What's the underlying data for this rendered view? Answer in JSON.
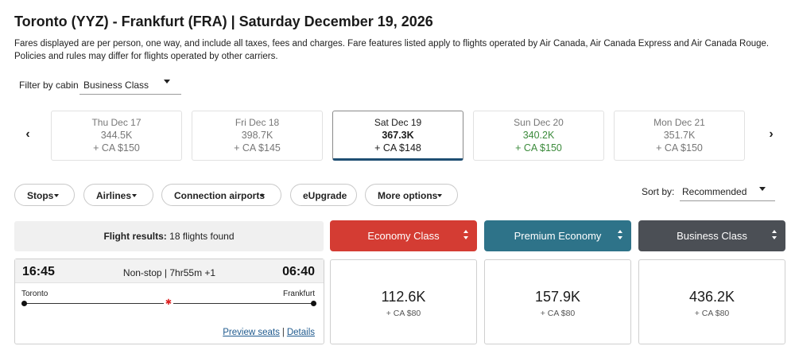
{
  "header": {
    "title": "Toronto (YYZ) - Frankfurt (FRA)  |  Saturday December 19, 2026",
    "disclaimer": "Fares displayed are per person, one way, and include all taxes, fees and charges. Fare features listed apply to flights operated by Air Canada, Air Canada Express and Air Canada Rouge. Policies and rules may differ for flights operated by other carriers."
  },
  "cabin_filter": {
    "label": "Filter by cabin",
    "value": "Business Class"
  },
  "date_nav": {
    "prev_icon": "chevron-left-icon",
    "next_icon": "chevron-right-icon",
    "prev_glyph": "‹",
    "next_glyph": "›"
  },
  "dates": [
    {
      "date": "Thu Dec 17",
      "points": "344.5K",
      "taxes": "+ CA $150",
      "state": "normal"
    },
    {
      "date": "Fri Dec 18",
      "points": "398.7K",
      "taxes": "+ CA $145",
      "state": "normal"
    },
    {
      "date": "Sat Dec 19",
      "points": "367.3K",
      "taxes": "+ CA $148",
      "state": "selected"
    },
    {
      "date": "Sun Dec 20",
      "points": "340.2K",
      "taxes": "+ CA $150",
      "state": "lowest"
    },
    {
      "date": "Mon Dec 21",
      "points": "351.7K",
      "taxes": "+ CA $150",
      "state": "normal"
    }
  ],
  "filters": {
    "stops": "Stops",
    "airlines": "Airlines",
    "connection_airports": "Connection airports",
    "eupgrade": "eUpgrade",
    "more_options": "More options"
  },
  "sort": {
    "label": "Sort by:",
    "value": "Recommended"
  },
  "results": {
    "label": "Flight results:",
    "count_text": "18 flights found"
  },
  "cabin_headers": {
    "economy": {
      "label": "Economy Class",
      "color": "#d43c33"
    },
    "premium": {
      "label": "Premium Economy",
      "color": "#2e7389"
    },
    "business": {
      "label": "Business Class",
      "color": "#4b4f55"
    }
  },
  "flight": {
    "departure_time": "16:45",
    "arrival_time": "06:40",
    "duration": "Non-stop | 7hr55m +1",
    "origin": "Toronto",
    "destination": "Frankfurt",
    "airline_icon": "maple-leaf-icon",
    "airline_glyph": "✱",
    "preview_seats": "Preview seats",
    "separator": "|",
    "details": "Details",
    "fares": {
      "economy": {
        "points": "112.6K",
        "taxes": "+ CA $80"
      },
      "premium": {
        "points": "157.9K",
        "taxes": "+ CA $80"
      },
      "business": {
        "points": "436.2K",
        "taxes": "+ CA $80"
      }
    }
  },
  "colors": {
    "accent_selected_underline": "#1f4f73",
    "lowest_price": "#3c8b3c",
    "link": "#1f5a8e"
  }
}
